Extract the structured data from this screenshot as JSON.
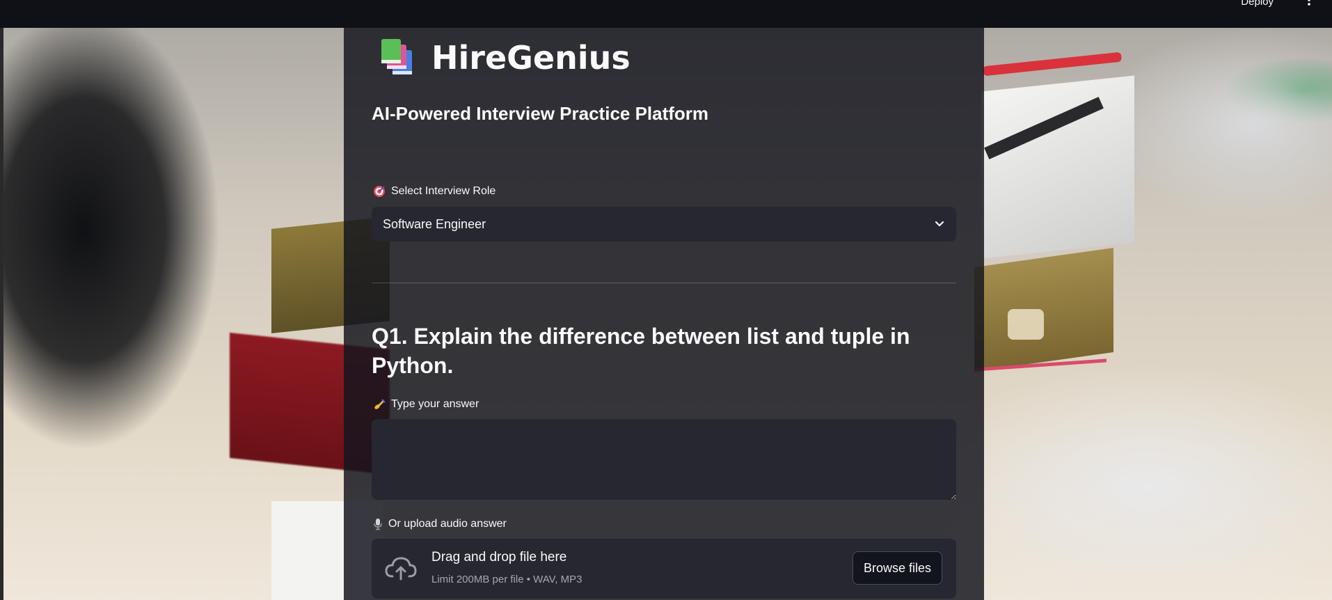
{
  "topbar": {
    "deploy_label": "Deploy",
    "menu_icon": "more-vertical-icon"
  },
  "app": {
    "icon": "books-icon",
    "title": "HireGenius",
    "subtitle": "AI-Powered Interview Practice Platform"
  },
  "role_select": {
    "icon": "target-icon",
    "label": "Select Interview Role",
    "value": "Software Engineer"
  },
  "question": {
    "text": "Q1. Explain the difference between list and tuple in Python."
  },
  "answer": {
    "icon": "writing-hand-icon",
    "label": "Type your answer",
    "value": ""
  },
  "audio_upload": {
    "icon": "microphone-icon",
    "label": "Or upload audio answer",
    "drop_title": "Drag and drop file here",
    "limit_text": "Limit 200MB per file • WAV, MP3",
    "browse_label": "Browse files",
    "upload_icon": "cloud-upload-icon"
  },
  "colors": {
    "panel_bg": "#14161e",
    "input_bg": "#262730",
    "text": "#fafafa",
    "topbar_bg": "#0f1116"
  }
}
